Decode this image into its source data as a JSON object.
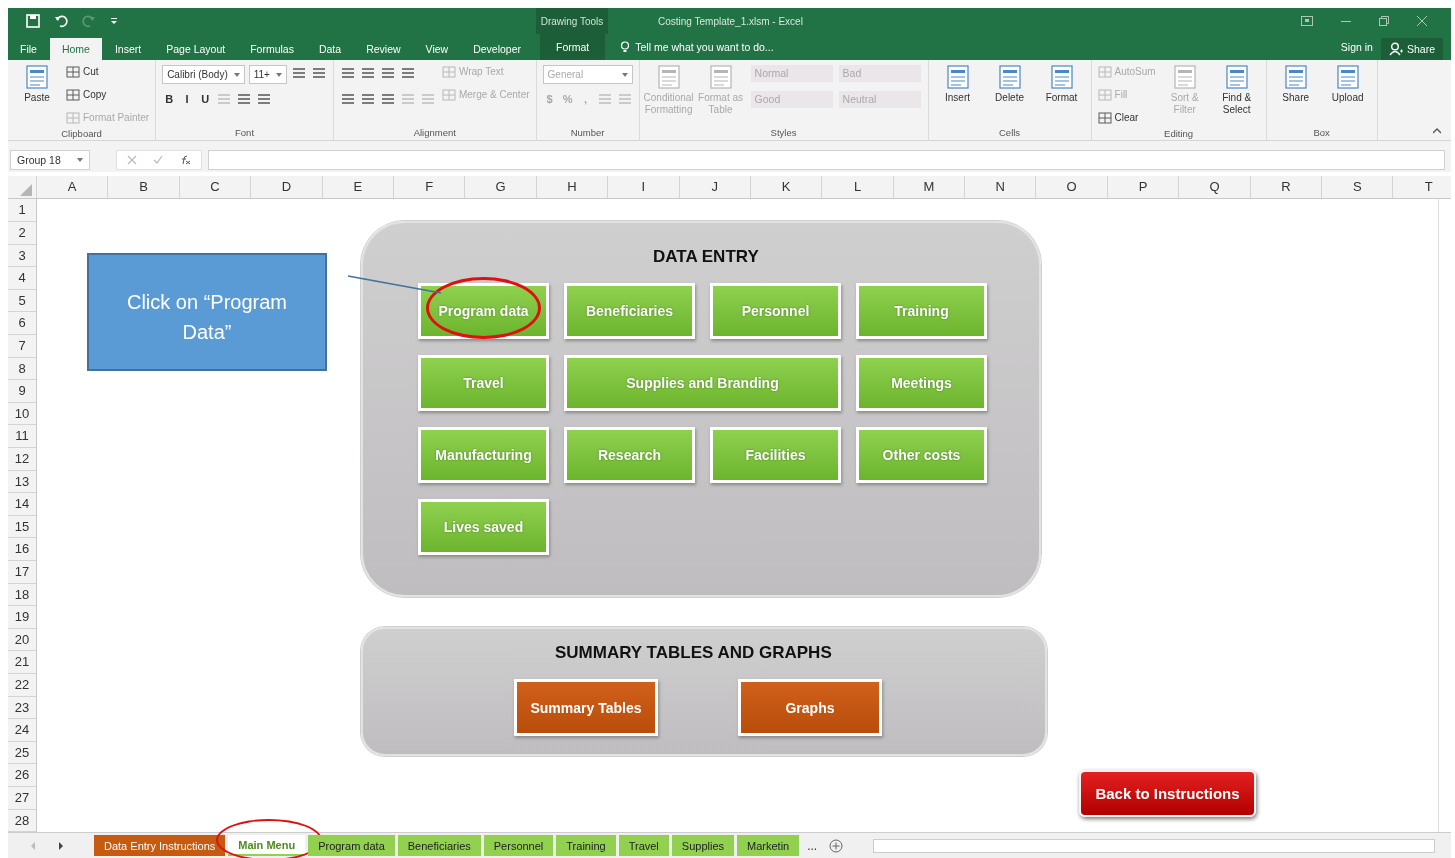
{
  "title_bar": {
    "context_label": "Drawing Tools",
    "title": "Costing Template_1.xlsm - Excel"
  },
  "ribbon_tabs": [
    {
      "label": "File",
      "selected": false,
      "kind": "standard"
    },
    {
      "label": "Home",
      "selected": true,
      "kind": "standard"
    },
    {
      "label": "Insert",
      "selected": false,
      "kind": "standard"
    },
    {
      "label": "Page Layout",
      "selected": false,
      "kind": "standard"
    },
    {
      "label": "Formulas",
      "selected": false,
      "kind": "standard"
    },
    {
      "label": "Data",
      "selected": false,
      "kind": "standard"
    },
    {
      "label": "Review",
      "selected": false,
      "kind": "standard"
    },
    {
      "label": "View",
      "selected": false,
      "kind": "standard"
    },
    {
      "label": "Developer",
      "selected": false,
      "kind": "standard"
    },
    {
      "label": "Format",
      "selected": false,
      "kind": "contextual"
    }
  ],
  "tell_me": "Tell me what you want to do...",
  "account": {
    "sign_in": "Sign in",
    "share": "Share"
  },
  "ribbon_groups": [
    {
      "label": "Clipboard",
      "columns": [
        [
          {
            "kind": "large",
            "label": "Paste",
            "disabled": false
          }
        ],
        [
          {
            "kind": "small",
            "label": "Cut",
            "disabled": false
          },
          {
            "kind": "small",
            "label": "Copy",
            "disabled": false
          },
          {
            "kind": "small",
            "label": "Format Painter",
            "disabled": true
          }
        ]
      ]
    },
    {
      "label": "Font",
      "columns": [
        [
          {
            "kind": "row",
            "items": [
              {
                "kind": "field",
                "label": "Calibri (Body)",
                "disabled": false
              },
              {
                "kind": "field",
                "label": "11+",
                "disabled": false
              },
              {
                "kind": "icon",
                "disabled": false
              },
              {
                "kind": "icon",
                "disabled": false
              }
            ]
          },
          {
            "kind": "row",
            "items": [
              {
                "kind": "glyph",
                "label": "B",
                "disabled": false
              },
              {
                "kind": "glyph",
                "label": "I",
                "disabled": false
              },
              {
                "kind": "glyph",
                "label": "U",
                "disabled": false
              },
              {
                "kind": "icon",
                "disabled": true
              },
              {
                "kind": "icon",
                "disabled": false
              },
              {
                "kind": "icon",
                "disabled": false
              }
            ]
          }
        ]
      ]
    },
    {
      "label": "Alignment",
      "columns": [
        [
          {
            "kind": "row",
            "items": [
              {
                "kind": "icon",
                "disabled": false
              },
              {
                "kind": "icon",
                "disabled": false
              },
              {
                "kind": "icon",
                "disabled": false
              },
              {
                "kind": "icon",
                "disabled": false
              }
            ]
          },
          {
            "kind": "row",
            "items": [
              {
                "kind": "icon",
                "disabled": false
              },
              {
                "kind": "icon",
                "disabled": false
              },
              {
                "kind": "icon",
                "disabled": false
              },
              {
                "kind": "icon",
                "disabled": true
              },
              {
                "kind": "icon",
                "disabled": true
              }
            ]
          }
        ],
        [
          {
            "kind": "small",
            "label": "Wrap Text",
            "disabled": true
          },
          {
            "kind": "small",
            "label": "Merge & Center",
            "disabled": true
          }
        ]
      ]
    },
    {
      "label": "Number",
      "columns": [
        [
          {
            "kind": "field",
            "label": "General",
            "disabled": true
          },
          {
            "kind": "row",
            "items": [
              {
                "kind": "glyph",
                "label": "$",
                "disabled": true
              },
              {
                "kind": "glyph",
                "label": "%",
                "disabled": true
              },
              {
                "kind": "glyph",
                "label": ",",
                "disabled": true
              },
              {
                "kind": "icon",
                "disabled": true
              },
              {
                "kind": "icon",
                "disabled": true
              }
            ]
          }
        ]
      ]
    },
    {
      "label": "Styles",
      "columns": [
        [
          {
            "kind": "large",
            "label": "Conditional Formatting",
            "disabled": true
          }
        ],
        [
          {
            "kind": "large",
            "label": "Format as Table",
            "disabled": true
          }
        ],
        [
          {
            "kind": "row",
            "items": [
              {
                "kind": "style",
                "label": "Normal",
                "disabled": true
              },
              {
                "kind": "style",
                "label": "Bad",
                "disabled": true
              }
            ]
          },
          {
            "kind": "row",
            "items": [
              {
                "kind": "style",
                "label": "Good",
                "disabled": true
              },
              {
                "kind": "style",
                "label": "Neutral",
                "disabled": true
              }
            ]
          }
        ]
      ]
    },
    {
      "label": "Cells",
      "columns": [
        [
          {
            "kind": "large",
            "label": "Insert",
            "disabled": false
          }
        ],
        [
          {
            "kind": "large",
            "label": "Delete",
            "disabled": false
          }
        ],
        [
          {
            "kind": "large",
            "label": "Format",
            "disabled": false
          }
        ]
      ]
    },
    {
      "label": "Editing",
      "columns": [
        [
          {
            "kind": "small",
            "label": "AutoSum",
            "disabled": true
          },
          {
            "kind": "small",
            "label": "Fill",
            "disabled": true
          },
          {
            "kind": "small",
            "label": "Clear",
            "disabled": false
          }
        ],
        [
          {
            "kind": "large",
            "label": "Sort & Filter",
            "disabled": true
          }
        ],
        [
          {
            "kind": "large",
            "label": "Find & Select",
            "disabled": false
          }
        ]
      ]
    },
    {
      "label": "Box",
      "columns": [
        [
          {
            "kind": "large",
            "label": "Share",
            "disabled": false
          }
        ],
        [
          {
            "kind": "large",
            "label": "Upload",
            "disabled": false
          }
        ]
      ]
    }
  ],
  "name_box": "Group 18",
  "sheet": {
    "columns": [
      "A",
      "B",
      "C",
      "D",
      "E",
      "F",
      "G",
      "H",
      "I",
      "J",
      "K",
      "L",
      "M",
      "N",
      "O",
      "P",
      "Q",
      "R",
      "S",
      "T"
    ],
    "rows": [
      "1",
      "2",
      "3",
      "4",
      "5",
      "6",
      "7",
      "8",
      "9",
      "10",
      "11",
      "12",
      "13",
      "14",
      "15",
      "16",
      "17",
      "18",
      "19",
      "20",
      "21",
      "22",
      "23",
      "24",
      "25",
      "26",
      "27",
      "28"
    ]
  },
  "callout": "Click on “Program Data”",
  "data_entry": {
    "title": "DATA ENTRY",
    "buttons": [
      {
        "label": "Program data",
        "kind": "normal",
        "highlighted": true
      },
      {
        "label": "Beneficiaries",
        "kind": "normal",
        "highlighted": false
      },
      {
        "label": "Personnel",
        "kind": "normal",
        "highlighted": false
      },
      {
        "label": "Training",
        "kind": "normal",
        "highlighted": false
      },
      {
        "label": "Travel",
        "kind": "normal",
        "highlighted": false
      },
      {
        "label": "Supplies and Branding",
        "kind": "wide",
        "highlighted": false
      },
      {
        "label": "Meetings",
        "kind": "normal",
        "highlighted": false
      },
      {
        "label": "Manufacturing",
        "kind": "normal",
        "highlighted": false
      },
      {
        "label": "Research",
        "kind": "normal",
        "highlighted": false
      },
      {
        "label": "Facilities",
        "kind": "normal",
        "highlighted": false
      },
      {
        "label": "Other costs",
        "kind": "normal",
        "highlighted": false
      },
      {
        "label": "Lives saved",
        "kind": "normal",
        "highlighted": false
      }
    ]
  },
  "summary": {
    "title": "SUMMARY TABLES AND GRAPHS",
    "buttons": [
      "Summary Tables",
      "Graphs"
    ]
  },
  "back_button": "Back to Instructions",
  "sheet_tabs": [
    {
      "label": "Data Entry Instructions",
      "selected": false,
      "highlighted": false,
      "color": "#c55a11"
    },
    {
      "label": "Main Menu",
      "selected": true,
      "highlighted": true,
      "color": "#92d050"
    },
    {
      "label": "Program data",
      "selected": false,
      "highlighted": false,
      "color": "#92d050"
    },
    {
      "label": "Beneficiaries",
      "selected": false,
      "highlighted": false,
      "color": "#92d050"
    },
    {
      "label": "Personnel",
      "selected": false,
      "highlighted": false,
      "color": "#92d050"
    },
    {
      "label": "Training",
      "selected": false,
      "highlighted": false,
      "color": "#92d050"
    },
    {
      "label": "Travel",
      "selected": false,
      "highlighted": false,
      "color": "#92d050"
    },
    {
      "label": "Supplies",
      "selected": false,
      "highlighted": false,
      "color": "#92d050"
    },
    {
      "label": "Marketin",
      "selected": false,
      "highlighted": false,
      "color": "#92d050"
    }
  ],
  "more_tabs": "..."
}
